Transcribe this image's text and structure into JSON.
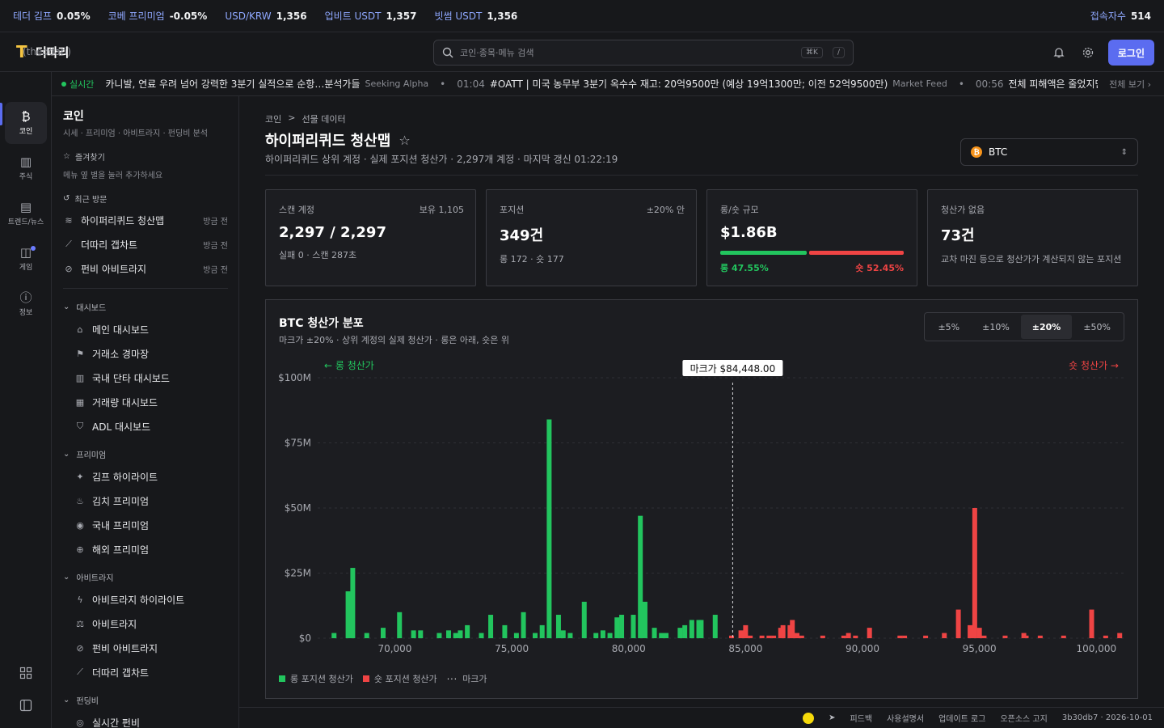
{
  "ticker": {
    "items": [
      {
        "label": "테더 김프",
        "value": "0.05%"
      },
      {
        "label": "코베 프리미엄",
        "value": "-0.05%"
      },
      {
        "label": "USD/KRW",
        "value": "1,356"
      },
      {
        "label": "업비트 USDT",
        "value": "1,357"
      },
      {
        "label": "빗썸 USDT",
        "value": "1,356"
      }
    ],
    "visitors_label": "접속자수",
    "visitors_value": "514"
  },
  "header": {
    "logo_mark": "T",
    "app_name": "더따리",
    "app_sub": "(theddari)",
    "search_placeholder": "코인·종목·메뉴 검색",
    "kbd1": "⌘K",
    "kbd2": "/",
    "login": "로그인"
  },
  "news": {
    "live": "실시간",
    "items": [
      {
        "time": "",
        "text": "카니발, 연료 우려 넘어 강력한 3분기 실적으로 순항…분석가들",
        "source": "Seeking Alpha"
      },
      {
        "time": "01:04",
        "text": "#OATT | 미국 농무부 3분기 옥수수 재고: 20억9500만 (예상 19억1300만; 이전 52억9500만)",
        "source": "Market Feed"
      },
      {
        "time": "00:56",
        "text": "전체 피해액은 줄었지만 해킹",
        "source": ""
      }
    ],
    "sep": "•",
    "see_all": "전체 보기 ›"
  },
  "rail": {
    "items": [
      {
        "icon": "₿",
        "label": "코인"
      },
      {
        "icon": "▥",
        "label": "주식"
      },
      {
        "icon": "▤",
        "label": "트렌드/뉴스"
      },
      {
        "icon": "◫",
        "label": "게임"
      },
      {
        "icon": "ⓘ",
        "label": "정보"
      }
    ],
    "bottom_icons": [
      "grid-icon",
      "sidebar-toggle-icon"
    ]
  },
  "sidebar": {
    "title": "코인",
    "subtitle": "시세 · 프리미엄 · 아비트라지 · 펀딩비 분석",
    "favorites_label": "즐겨찾기",
    "favorites_note": "메뉴 옆 별을 눌러 추가하세요",
    "recent_label": "최근 방문",
    "recent": [
      {
        "label": "하이퍼리퀴드 청산맵",
        "ago": "방금 전"
      },
      {
        "label": "더따리 갭차트",
        "ago": "방금 전"
      },
      {
        "label": "펀비 아비트라지",
        "ago": "방금 전"
      }
    ],
    "groups": [
      {
        "name": "대시보드",
        "items": [
          "메인 대시보드",
          "거래소 경마장",
          "국내 단타 대시보드",
          "거래량 대시보드",
          "ADL 대시보드"
        ]
      },
      {
        "name": "프리미엄",
        "items": [
          "김프 하이라이트",
          "김치 프리미엄",
          "국내 프리미엄",
          "해외 프리미엄"
        ]
      },
      {
        "name": "아비트라지",
        "items": [
          "아비트라지 하이라이트",
          "아비트라지",
          "펀비 아비트라지",
          "더따리 갭차트"
        ]
      },
      {
        "name": "펀딩비",
        "items": [
          "실시간 펀비"
        ]
      }
    ]
  },
  "page": {
    "crumb_root": "코인",
    "crumb_sep": ">",
    "crumb_current": "선물 데이터",
    "title": "하이퍼리퀴드 청산맵",
    "desc": "하이퍼리퀴드 상위 계정 · 실제 포지션 청산가 · 2,297개 계정 · 마지막 갱신 01:22:19",
    "coin": "BTC"
  },
  "cards": [
    {
      "label": "스캔 계정",
      "right": "보유 1,105",
      "value": "2,297 / 2,297",
      "sub": "실패 0 · 스캔 287초"
    },
    {
      "label": "포지션",
      "right": "±20% 안",
      "value": "349건",
      "sub": "롱 172 · 숏 177"
    },
    {
      "label": "롱/숏 규모",
      "right": "",
      "value": "$1.86B",
      "long": "롱 47.55%",
      "short": "숏 52.45%",
      "long_pct": 47.55
    },
    {
      "label": "청산가 없음",
      "right": "",
      "value": "73건",
      "sub": "교차 마진 등으로 청산가가 계산되지 않는 포지션"
    }
  ],
  "panel": {
    "title": "BTC 청산가 분포",
    "desc": "마크가 ±20% · 상위 계정의 실제 청산가 · 롱은 아래, 숏은 위",
    "ranges": [
      "±5%",
      "±10%",
      "±20%",
      "±50%"
    ],
    "active_range": "±20%",
    "legend": [
      "롱 포지션 청산가",
      "숏 포지션 청산가",
      "마크가"
    ]
  },
  "chart_data": {
    "type": "bar",
    "mark_price": 84448.0,
    "mark_label": "마크가 $84,448.00",
    "long_label": "← 롱 청산가",
    "short_label": "숏 청산가 →",
    "xlim": [
      66700,
      101200
    ],
    "ylim": [
      0,
      100
    ],
    "y_unit": "$M",
    "yticks": [
      0,
      25,
      50,
      75,
      100
    ],
    "ytick_labels": [
      "$0",
      "$25M",
      "$50M",
      "$75M",
      "$100M"
    ],
    "xticks": [
      70000,
      75000,
      80000,
      85000,
      90000,
      95000,
      100000
    ],
    "xtick_labels": [
      "70,000",
      "75,000",
      "80,000",
      "85,000",
      "90,000",
      "95,000",
      "100,000"
    ],
    "colors": {
      "long": "#22c55e",
      "short": "#ef4444"
    },
    "series": [
      {
        "name": "롱 포지션 청산가",
        "x": [
          67400,
          68000,
          68200,
          68800,
          69500,
          70200,
          70800,
          71100,
          71900,
          72300,
          72600,
          72800,
          73100,
          73700,
          74100,
          74700,
          75200,
          75500,
          76000,
          76300,
          76600,
          77000,
          77200,
          77500,
          78100,
          78600,
          78900,
          79200,
          79500,
          79700,
          80200,
          80500,
          80700,
          81100,
          81400,
          81600,
          82200,
          82400,
          82700,
          83000,
          83100,
          83700
        ],
        "values": [
          2,
          18,
          27,
          2,
          4,
          10,
          3,
          3,
          2,
          3,
          2,
          3,
          5,
          2,
          9,
          5,
          2,
          10,
          2,
          5,
          84,
          9,
          3,
          2,
          14,
          2,
          3,
          2,
          8,
          9,
          9,
          47,
          14,
          4,
          2,
          2,
          4,
          5,
          7,
          7,
          7,
          9
        ]
      },
      {
        "name": "숏 포지션 청산가",
        "x": [
          84400,
          84800,
          85000,
          85200,
          85700,
          86000,
          86200,
          86500,
          86600,
          86900,
          87000,
          87200,
          87400,
          88300,
          89200,
          89400,
          89700,
          90300,
          91600,
          91800,
          92700,
          93500,
          94100,
          94600,
          94800,
          95000,
          95200,
          96100,
          96900,
          97000,
          97600,
          98600,
          99800,
          100400,
          101000
        ],
        "values": [
          1,
          3,
          5,
          1,
          1,
          1,
          1,
          4,
          5,
          5,
          7,
          2,
          1,
          1,
          1,
          2,
          1,
          4,
          1,
          1,
          1,
          2,
          11,
          5,
          50,
          4,
          1,
          1,
          2,
          1,
          1,
          1,
          11,
          1,
          2
        ]
      }
    ]
  },
  "footer": {
    "links": [
      "피드백",
      "사용설명서",
      "업데이트 로그",
      "오픈소스 고지"
    ],
    "build": "3b30db7 · 2026-10-01"
  }
}
